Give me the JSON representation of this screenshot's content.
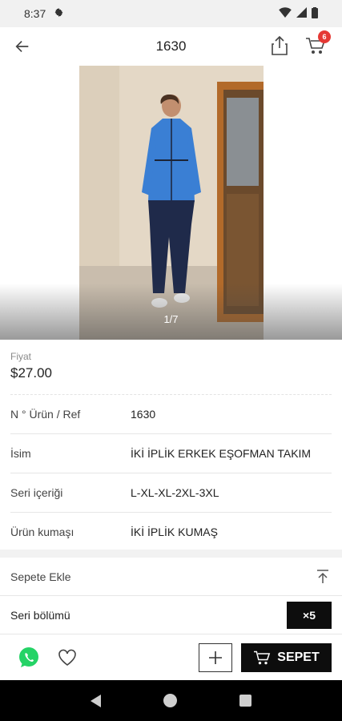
{
  "status_bar": {
    "time": "8:37"
  },
  "header": {
    "title": "1630",
    "cart_count": "6"
  },
  "gallery": {
    "counter": "1/7"
  },
  "price": {
    "label": "Fiyat",
    "value": "$27.00"
  },
  "details": [
    {
      "label": "N ° Ürün / Ref",
      "value": "1630"
    },
    {
      "label": "İsim",
      "value": "İKİ İPLİK ERKEK EŞOFMAN TAKIM"
    },
    {
      "label": "Seri içeriği",
      "value": "L-XL-XL-2XL-3XL"
    },
    {
      "label": "Ürün kumaşı",
      "value": "İKİ İPLİK KUMAŞ"
    }
  ],
  "add_to_cart": {
    "label": "Sepete Ekle"
  },
  "series": {
    "label": "Seri bölümü",
    "multiplier": "×5"
  },
  "actions": {
    "cart_button_label": "SEPET"
  },
  "colors": {
    "accent": "#0d0d0d",
    "badge": "#e53935",
    "whatsapp": "#25d366"
  }
}
